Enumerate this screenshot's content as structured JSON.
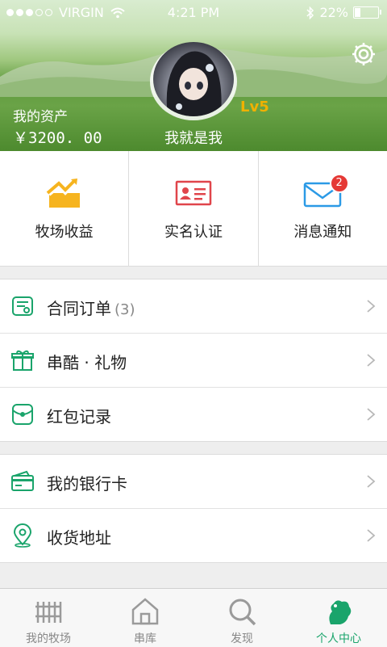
{
  "status_bar": {
    "carrier": "VIRGIN",
    "time": "4:21 PM",
    "battery": "22%",
    "battery_level": 0.22
  },
  "header": {
    "assets_label": "我的资产",
    "assets_value": "￥3200. 00",
    "username": "我就是我",
    "level": "Lv5",
    "settings_icon": "gear-icon"
  },
  "quick_actions": [
    {
      "label": "牧场收益",
      "icon": "chart-up-icon"
    },
    {
      "label": "实名认证",
      "icon": "id-card-icon"
    },
    {
      "label": "消息通知",
      "icon": "envelope-icon",
      "badge": "2"
    }
  ],
  "menu_groups": [
    [
      {
        "label": "合同订单",
        "count": "(3)",
        "icon": "contract-icon"
      },
      {
        "label": "串酷 · 礼物",
        "icon": "gift-icon"
      },
      {
        "label": "红包记录",
        "icon": "red-packet-icon"
      }
    ],
    [
      {
        "label": "我的银行卡",
        "icon": "bank-card-icon"
      },
      {
        "label": "收货地址",
        "icon": "location-icon"
      }
    ]
  ],
  "tabbar": [
    {
      "label": "我的牧场",
      "icon": "fence-icon",
      "active": false
    },
    {
      "label": "串库",
      "icon": "home-icon",
      "active": false
    },
    {
      "label": "发现",
      "icon": "search-icon",
      "active": false
    },
    {
      "label": "个人中心",
      "icon": "profile-icon",
      "active": true
    }
  ],
  "colors": {
    "accent": "#1aa46b",
    "level": "#f0b100",
    "badge": "#e53935"
  }
}
